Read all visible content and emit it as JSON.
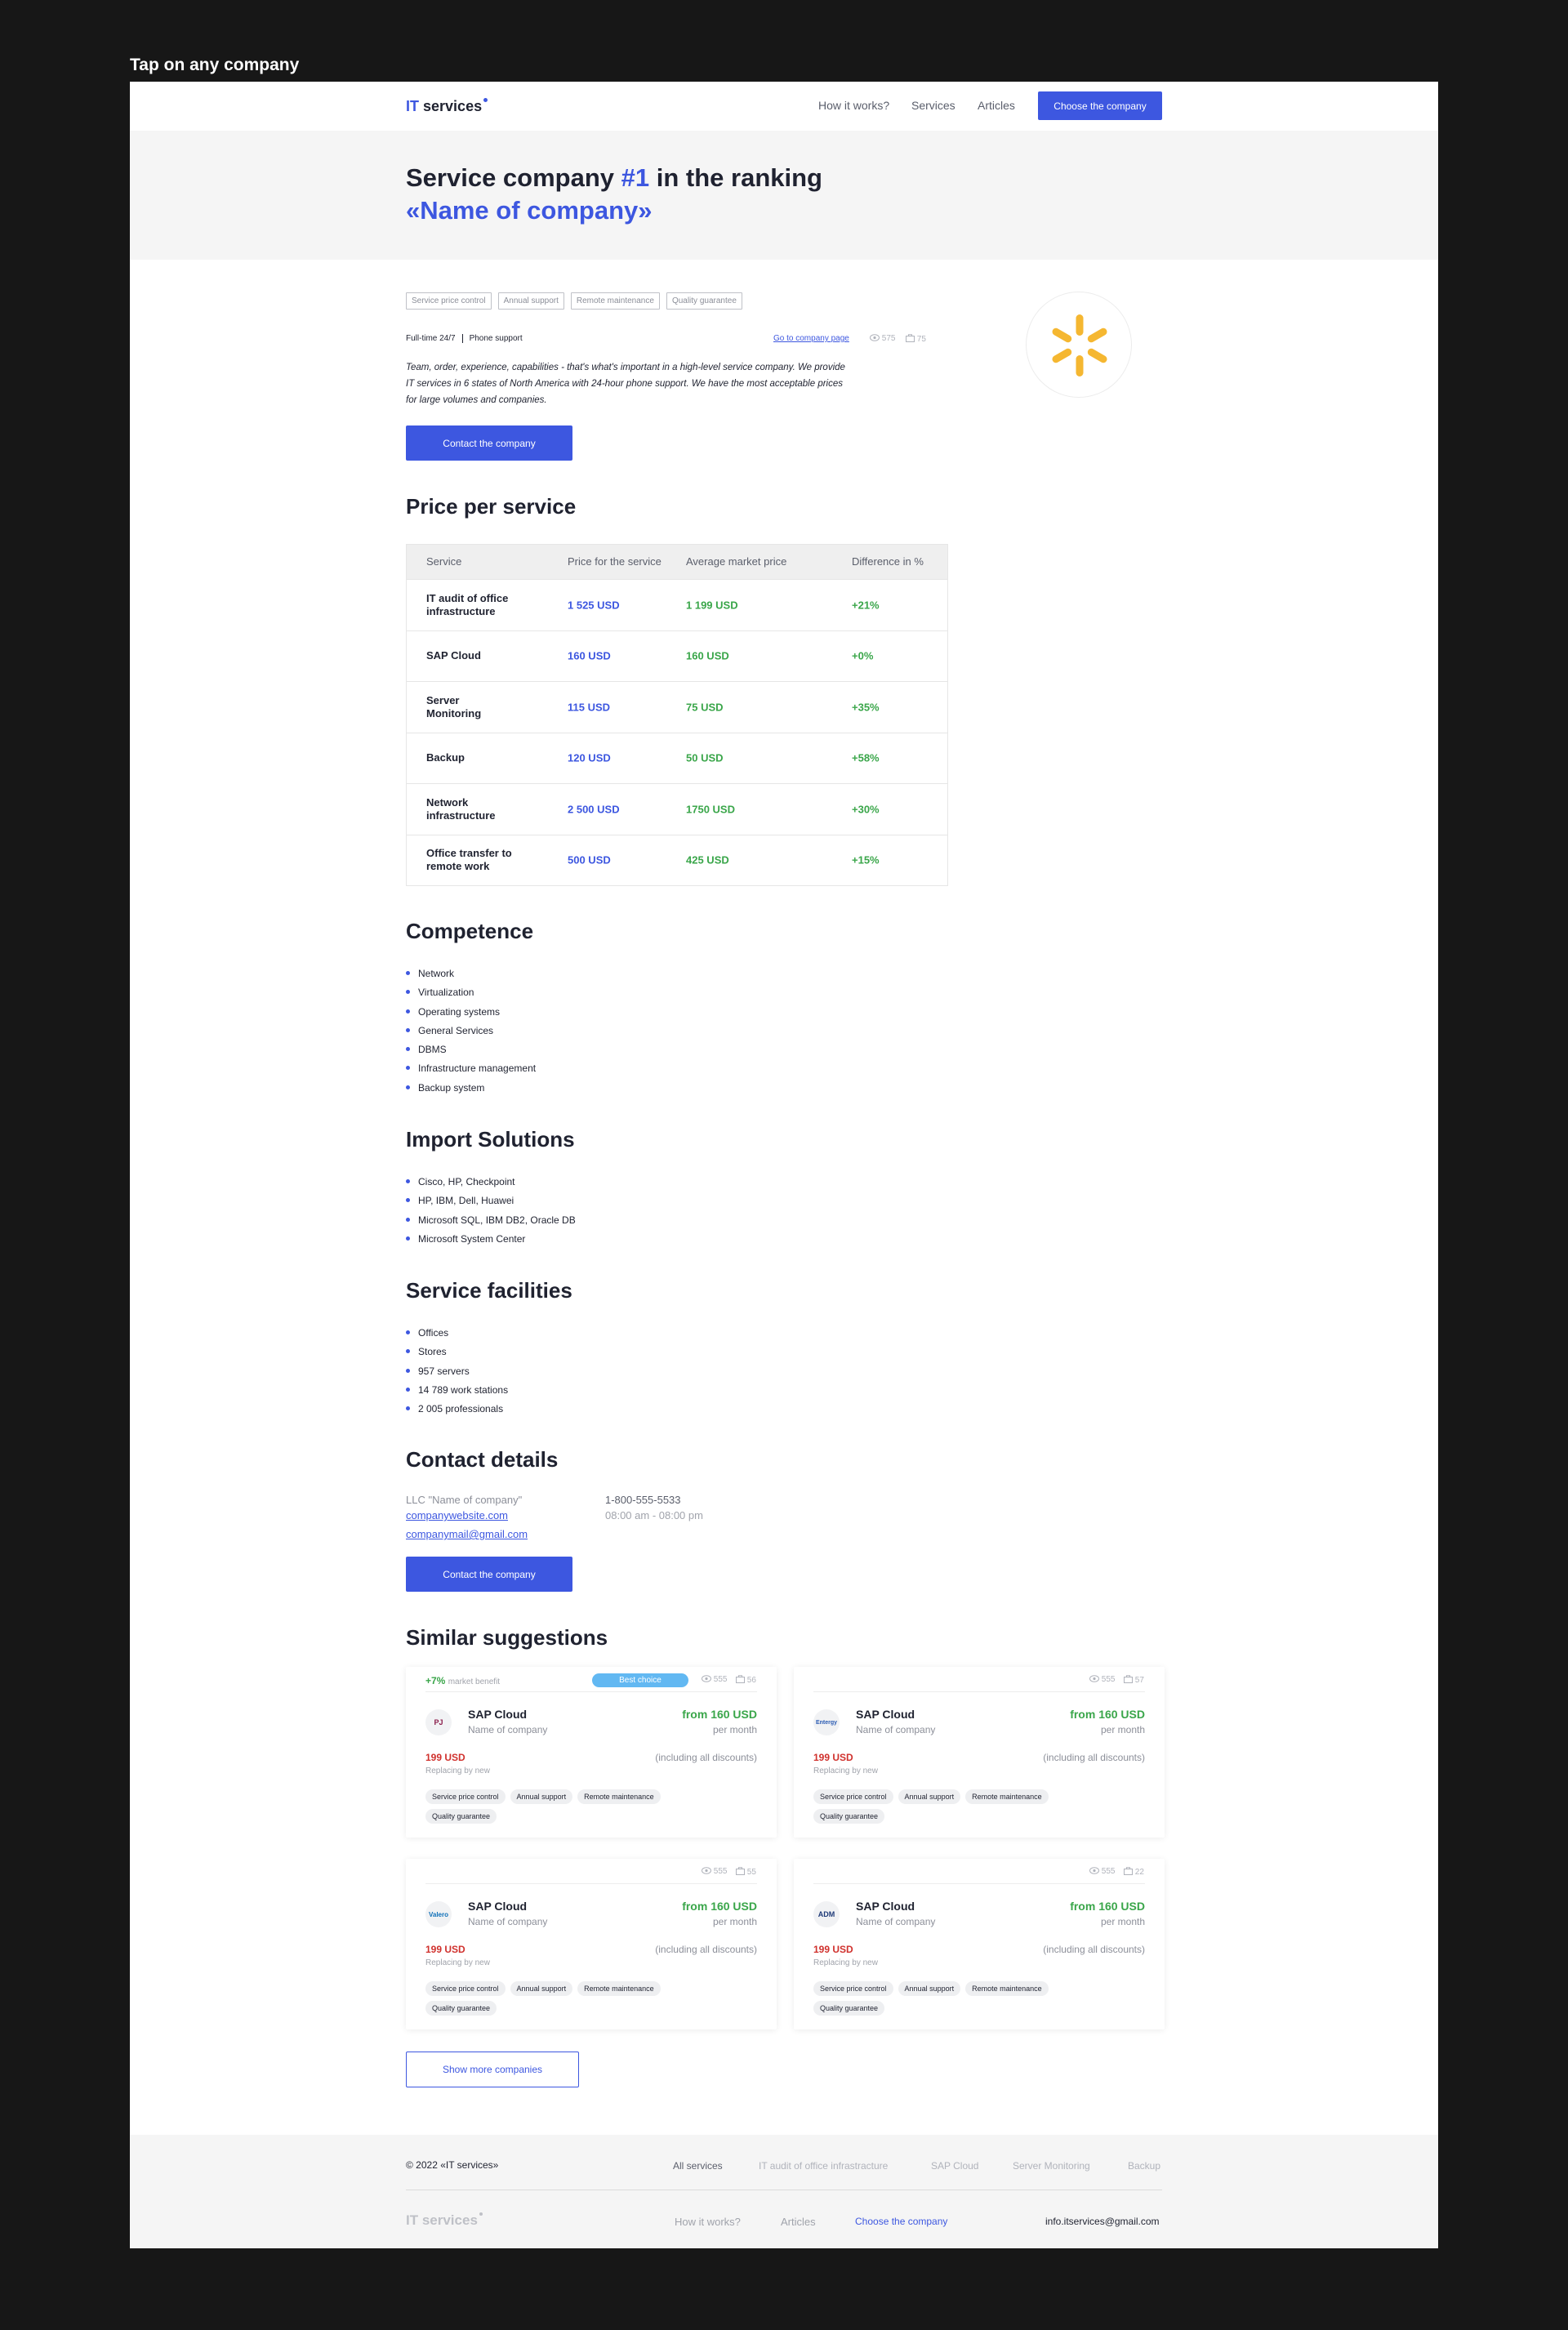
{
  "caption": "Tap on any company",
  "header": {
    "logo_it": "IT",
    "logo_services": "services",
    "nav": [
      "How it works?",
      "Services",
      "Articles"
    ],
    "cta": "Choose the company"
  },
  "hero": {
    "line1_pre": "Service company ",
    "line1_rank": "#1",
    "line1_post": " in the ranking",
    "line2": "«Name of company»"
  },
  "profile": {
    "tags": [
      "Service price control",
      "Annual support",
      "Remote maintenance",
      "Quality guarantee"
    ],
    "feature1": "Full-time 24/7",
    "feature2": "Phone support",
    "goto_link": "Go to company page",
    "views": "575",
    "orders": "75",
    "description": "Team, order, experience, capabilities - that's what's important in a high-level service company. We provide IT services in 6 states of North America with 24-hour phone support. We have the most acceptable prices for large volumes and companies.",
    "contact_button": "Contact the company",
    "logo_color": "#f5b731"
  },
  "prices": {
    "title": "Price per service",
    "headers": [
      "Service",
      "Price for the service",
      "Average market price",
      "Difference in %"
    ],
    "rows": [
      {
        "service": "IT audit of office infrastructure",
        "price": "1 525 USD",
        "avg": "1 199 USD",
        "diff": "+21%"
      },
      {
        "service": "SAP Cloud",
        "price": "160 USD",
        "avg": "160 USD",
        "diff": "+0%"
      },
      {
        "service": "Server Monitoring",
        "price": "115 USD",
        "avg": "75 USD",
        "diff": "+35%"
      },
      {
        "service": "Backup",
        "price": "120 USD",
        "avg": "50 USD",
        "diff": "+58%"
      },
      {
        "service": "Network infrastructure",
        "price": "2 500 USD",
        "avg": "1750 USD",
        "diff": "+30%"
      },
      {
        "service": "Office transfer to remote work",
        "price": "500 USD",
        "avg": "425 USD",
        "diff": "+15%"
      }
    ]
  },
  "competence": {
    "title": "Competence",
    "items": [
      "Network",
      "Virtualization",
      "Operating systems",
      "General Services",
      "DBMS",
      "Infrastructure management",
      "Backup system"
    ]
  },
  "import": {
    "title": "Import Solutions",
    "items": [
      "Cisco, HP, Checkpoint",
      "HP, IBM, Dell, Huawei",
      "Microsoft SQL, IBM DB2, Oracle DB",
      "Microsoft System Center"
    ]
  },
  "facilities": {
    "title": "Service facilities",
    "items": [
      "Offices",
      "Stores",
      "957 servers",
      "14 789 work stations",
      "2 005 professionals"
    ]
  },
  "contacts": {
    "title": "Contact details",
    "company": "LLC \"Name of company\"",
    "website": "companywebsite.com",
    "email": "companymail@gmail.com",
    "phone": "1-800-555-5533",
    "hours": "08:00 am - 08:00 pm",
    "button": "Contact the company"
  },
  "similar": {
    "title": "Similar suggestions",
    "best_label": "Best choice",
    "cards": [
      {
        "benefit": "+7%",
        "benefit_label": "market benefit",
        "best": true,
        "views": "555",
        "orders": "56",
        "logo": "PJ",
        "logo_color": "#8a1c4a",
        "title": "SAP Cloud",
        "company": "Name of company",
        "price": "from 160 USD",
        "per": "per month",
        "old": "199 USD",
        "discounts": "(including all discounts)",
        "replacing": "Replacing by new",
        "tags": [
          "Service price control",
          "Annual support",
          "Remote maintenance",
          "Quality guarantee"
        ]
      },
      {
        "benefit": "",
        "benefit_label": "",
        "best": false,
        "views": "555",
        "orders": "57",
        "logo": "Entergy",
        "logo_color": "#2a5bb3",
        "title": "SAP Cloud",
        "company": "Name of company",
        "price": "from 160 USD",
        "per": "per month",
        "old": "199 USD",
        "discounts": "(including all discounts)",
        "replacing": "Replacing by new",
        "tags": [
          "Service price control",
          "Annual support",
          "Remote maintenance",
          "Quality guarantee"
        ]
      },
      {
        "benefit": "",
        "benefit_label": "",
        "best": false,
        "views": "555",
        "orders": "55",
        "logo": "Valero",
        "logo_color": "#0d6fb8",
        "title": "SAP Cloud",
        "company": "Name of company",
        "price": "from 160 USD",
        "per": "per month",
        "old": "199 USD",
        "discounts": "(including all discounts)",
        "replacing": "Replacing by new",
        "tags": [
          "Service price control",
          "Annual support",
          "Remote maintenance",
          "Quality guarantee"
        ]
      },
      {
        "benefit": "",
        "benefit_label": "",
        "best": false,
        "views": "555",
        "orders": "22",
        "logo": "ADM",
        "logo_color": "#1e3a78",
        "title": "SAP Cloud",
        "company": "Name of company",
        "price": "from 160 USD",
        "per": "per month",
        "old": "199 USD",
        "discounts": "(including all discounts)",
        "replacing": "Replacing by new",
        "tags": [
          "Service price control",
          "Annual support",
          "Remote maintenance",
          "Quality guarantee"
        ]
      }
    ],
    "more_button": "Show more companies"
  },
  "footer": {
    "copyright": "© 2022 «IT services»",
    "links_top": [
      "All services",
      "IT audit of office infrastracture",
      "SAP Cloud",
      "Server Monitoring",
      "Backup"
    ],
    "logo": "IT services",
    "links_bottom": [
      "How it works?",
      "Articles",
      "Choose the company"
    ],
    "email": "info.itservices@gmail.com"
  },
  "colors": {
    "accent": "#3d57e0",
    "positive": "#3aa64a",
    "negative": "#d0312d",
    "best_badge": "#62b8f2"
  }
}
